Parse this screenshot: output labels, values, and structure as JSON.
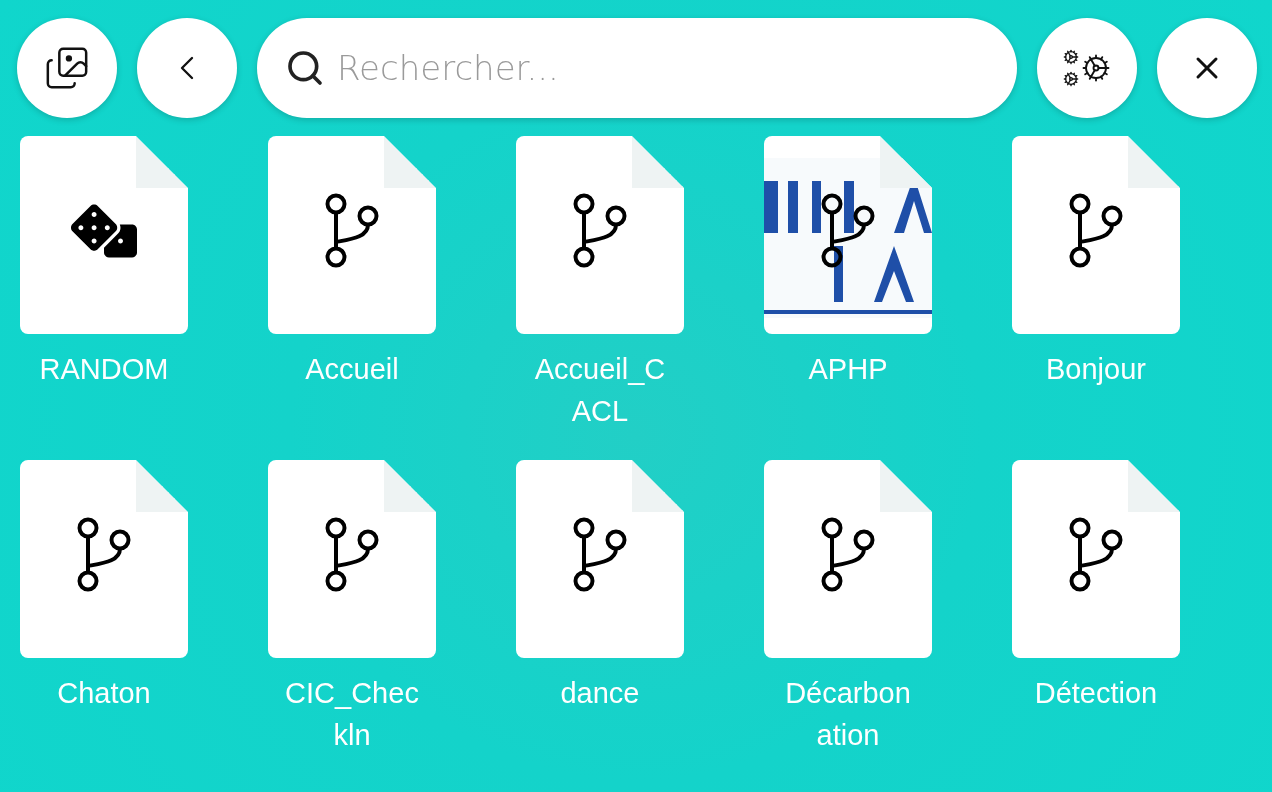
{
  "toolbar": {
    "search": {
      "placeholder": "Rechercher..."
    }
  },
  "items": [
    {
      "label": "RANDOM",
      "kind": "random",
      "picture": false
    },
    {
      "label": "Accueil",
      "kind": "scenario",
      "picture": false
    },
    {
      "label": "Accueil_CACL",
      "kind": "scenario",
      "picture": false
    },
    {
      "label": "APHP",
      "kind": "scenario",
      "picture": true
    },
    {
      "label": "Bonjour",
      "kind": "scenario",
      "picture": false
    },
    {
      "label": "Chaton",
      "kind": "scenario",
      "picture": false
    },
    {
      "label": "CIC_Checkln",
      "kind": "scenario",
      "picture": false
    },
    {
      "label": "dance",
      "kind": "scenario",
      "picture": false
    },
    {
      "label": "Décarbonation",
      "kind": "scenario",
      "picture": false
    },
    {
      "label": "Détection",
      "kind": "scenario",
      "picture": false
    }
  ]
}
